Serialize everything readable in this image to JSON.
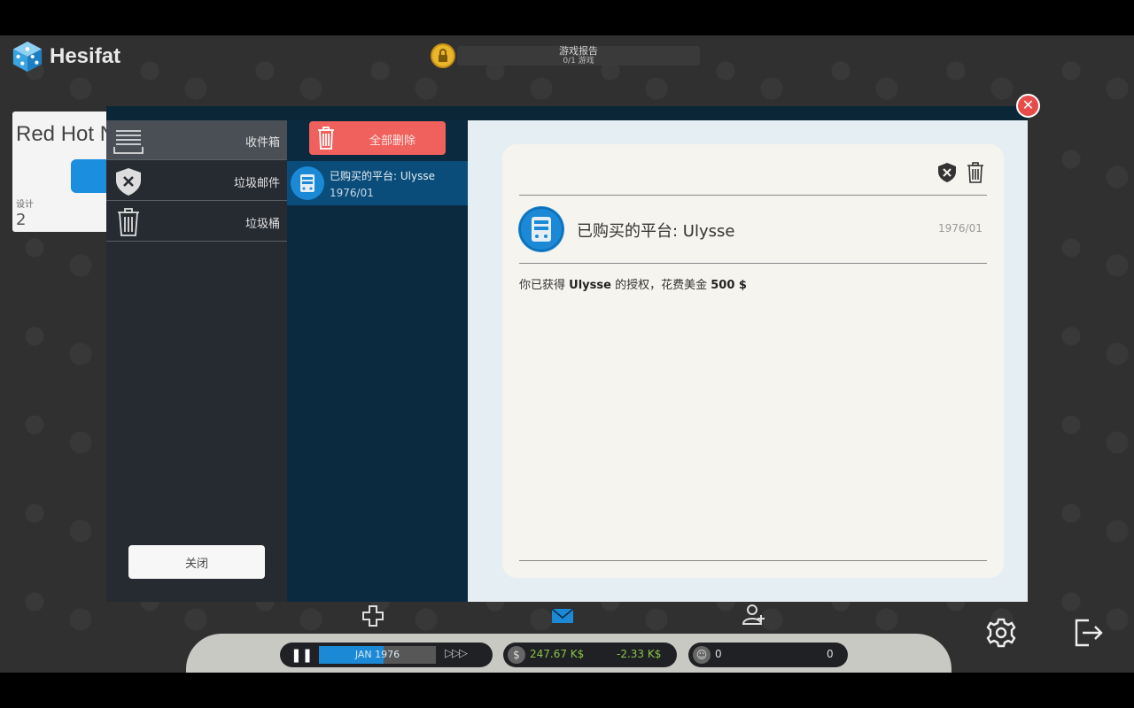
{
  "app": {
    "brand": "Hesifat",
    "report_title": "游戏报告",
    "report_sub": "0/1 游戏"
  },
  "background_card": {
    "title": "Red Hot N",
    "label": "设计",
    "value": "2"
  },
  "mail": {
    "folders": [
      {
        "label": "收件箱",
        "icon": "inbox-icon",
        "active": true
      },
      {
        "label": "垃圾邮件",
        "icon": "shield-x-icon",
        "active": false
      },
      {
        "label": "垃圾桶",
        "icon": "trash-icon",
        "active": false
      }
    ],
    "close_label": "关闭",
    "delete_all_label": "全部删除",
    "messages": [
      {
        "subject": "已购买的平台: Ulysse",
        "date": "1976/01",
        "icon": "console-icon"
      }
    ],
    "detail": {
      "subject": "已购买的平台: Ulysse",
      "date": "1976/01",
      "body_prefix": "你已获得",
      "body_platform": "Ulysse",
      "body_mid": "的授权，花费美金",
      "body_amount": "500 $"
    }
  },
  "hud": {
    "date_label": "JAN 1976",
    "progress": 0.55,
    "money": "247.67 K$",
    "delta": "-2.33 K$",
    "fans_left": "0",
    "fans_right": "0"
  },
  "colors": {
    "accent_blue": "#1b89d6",
    "delete_red": "#f0605c",
    "close_red": "#e94b4b",
    "money_green": "#8bc34a"
  }
}
